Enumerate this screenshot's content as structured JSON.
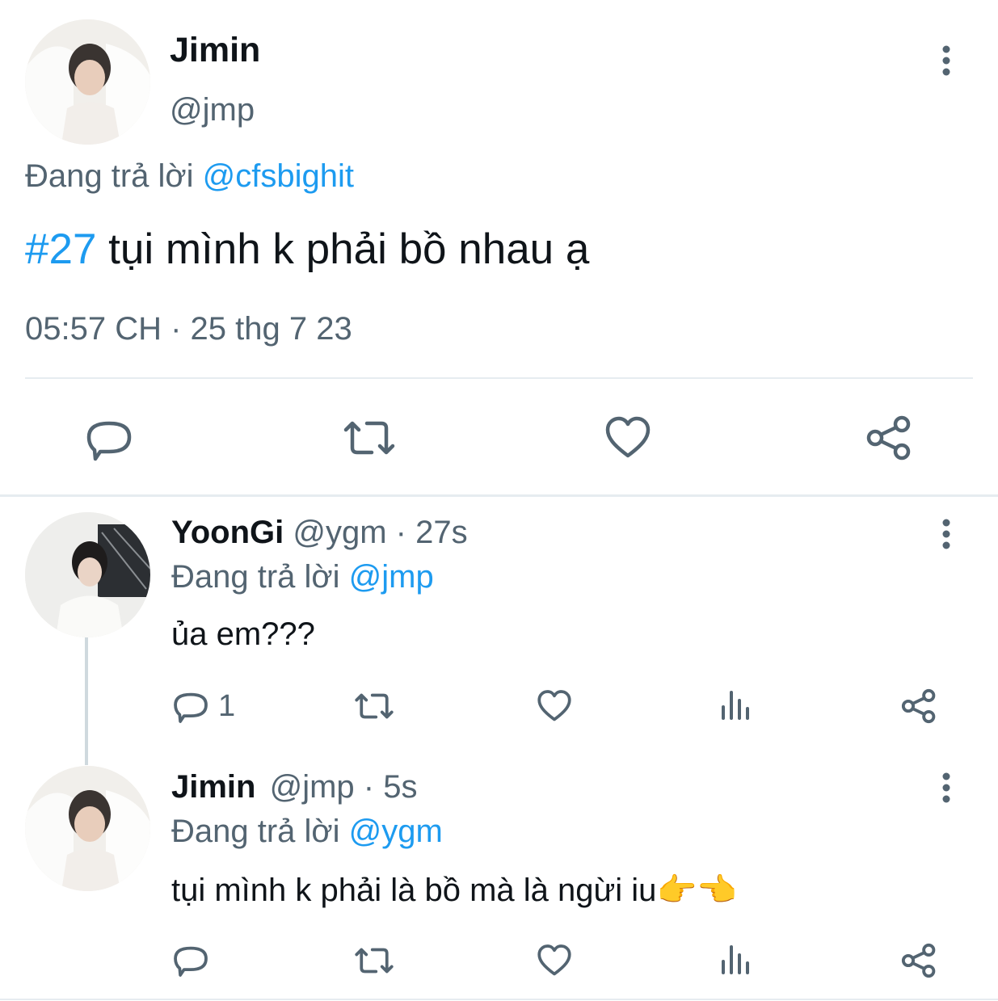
{
  "main_tweet": {
    "author_name": "Jimin",
    "author_handle": "@jmp",
    "reply_prefix": "Đang trả lời",
    "reply_to": "@cfsbighit",
    "hashtag": "#27",
    "text": "tụi mình k phải bồ nhau ạ",
    "timestamp": "05:57 CH · 25 thg 7 23"
  },
  "replies": [
    {
      "author_name": "YoonGi",
      "author_handle": "@ygm",
      "time": "· 27s",
      "reply_prefix": "Đang trả lời",
      "reply_to": "@jmp",
      "text": "ủa em???",
      "reply_count": "1"
    },
    {
      "author_name": "Jimin",
      "author_handle": "@jmp",
      "time": "· 5s",
      "reply_prefix": "Đang trả lời",
      "reply_to": "@ygm",
      "text": "tụi mình k phải là bồ mà là ngừi iu",
      "emoji": "👉👈"
    }
  ],
  "icons": {
    "more": "more-vertical-icon",
    "reply": "reply-bubble-icon",
    "retweet": "retweet-icon",
    "like": "heart-icon",
    "share": "share-icon",
    "views": "views-bar-chart-icon"
  },
  "colors": {
    "accent": "#1d9bf0",
    "text": "#0f1419",
    "muted": "#536471",
    "divider": "#e6ecf0"
  }
}
